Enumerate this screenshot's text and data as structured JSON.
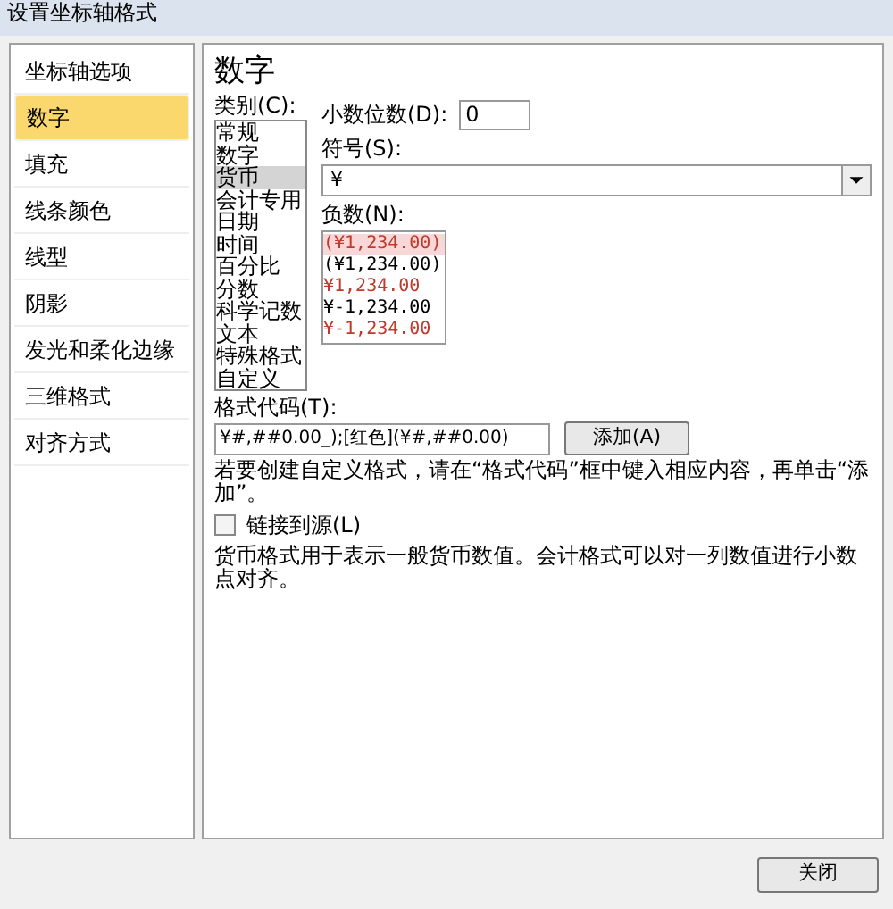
{
  "window": {
    "title": "设置坐标轴格式"
  },
  "sidebar": {
    "items": [
      {
        "label": "坐标轴选项",
        "selected": false
      },
      {
        "label": "数字",
        "selected": true
      },
      {
        "label": "填充",
        "selected": false
      },
      {
        "label": "线条颜色",
        "selected": false
      },
      {
        "label": "线型",
        "selected": false
      },
      {
        "label": "阴影",
        "selected": false
      },
      {
        "label": "发光和柔化边缘",
        "selected": false
      },
      {
        "label": "三维格式",
        "selected": false
      },
      {
        "label": "对齐方式",
        "selected": false
      }
    ]
  },
  "panel": {
    "heading": "数字",
    "category_label": "类别(C):",
    "categories": [
      {
        "label": "常规",
        "selected": false
      },
      {
        "label": "数字",
        "selected": false
      },
      {
        "label": "货币",
        "selected": true
      },
      {
        "label": "会计专用",
        "selected": false
      },
      {
        "label": "日期",
        "selected": false
      },
      {
        "label": "时间",
        "selected": false
      },
      {
        "label": "百分比",
        "selected": false
      },
      {
        "label": "分数",
        "selected": false
      },
      {
        "label": "科学记数",
        "selected": false
      },
      {
        "label": "文本",
        "selected": false
      },
      {
        "label": "特殊格式",
        "selected": false
      },
      {
        "label": "自定义",
        "selected": false
      }
    ],
    "decimals": {
      "label": "小数位数(D):",
      "value": "0"
    },
    "symbol": {
      "label": "符号(S):",
      "value": "¥"
    },
    "negative_label": "负数(N):",
    "negatives": [
      {
        "label": "(¥1,234.00)",
        "selected": true,
        "color": "#c0392b"
      },
      {
        "label": "(¥1,234.00)",
        "selected": false,
        "color": "#000000"
      },
      {
        "label": "¥1,234.00",
        "selected": false,
        "color": "#c0392b"
      },
      {
        "label": "¥-1,234.00",
        "selected": false,
        "color": "#000000"
      },
      {
        "label": "¥-1,234.00",
        "selected": false,
        "color": "#c0392b"
      }
    ],
    "format_code": {
      "label": "格式代码(T):",
      "value": "¥#,##0.00_);[红色](¥#,##0.00)"
    },
    "add_button": "添加(A)",
    "hint": "若要创建自定义格式，请在“格式代码”框中键入相应内容，再单击“添加”。",
    "link_source": {
      "label": "链接到源(L)",
      "checked": false
    },
    "description": "货币格式用于表示一般货币数值。会计格式可以对一列数值进行小数点对齐。"
  },
  "buttons": [
    "关闭"
  ]
}
